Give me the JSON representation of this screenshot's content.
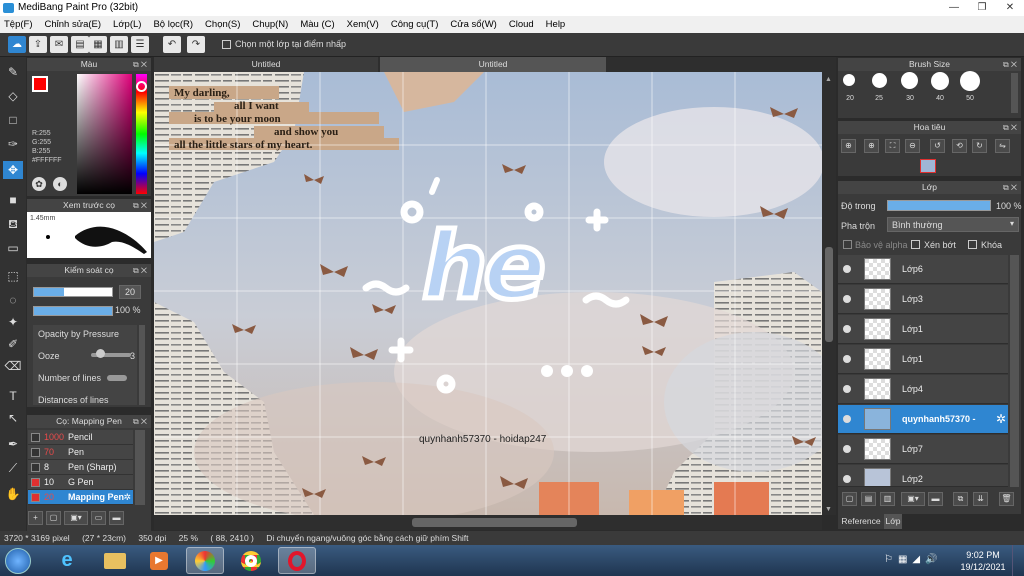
{
  "window": {
    "title": "MediBang Paint Pro (32bit)",
    "controls": [
      "—",
      "❐",
      "✕"
    ]
  },
  "menu": [
    "Tệp(F)",
    "Chỉnh sửa(E)",
    "Lớp(L)",
    "Bộ lọc(R)",
    "Chọn(S)",
    "Chụp(N)",
    "Màu (C)",
    "Xem(V)",
    "Công cụ(T)",
    "Cửa sổ(W)",
    "Cloud",
    "Help"
  ],
  "toolbar": {
    "select_layer_label": "Chọn một lớp tại điểm nhấp"
  },
  "color_panel": {
    "title": "Màu",
    "rgb": [
      "R:255",
      "G:255",
      "B:255"
    ],
    "hex": "#FFFFFF",
    "primary_color": "#ff0000",
    "secondary_color": "#ffffff"
  },
  "brush_preview": {
    "title": "Xem trước cọ",
    "size": "1.45mm"
  },
  "brush_control": {
    "title": "Kiểm soát cọ",
    "size_value": "20",
    "opacity_value": "100 %",
    "opacity_by_pressure": "Opacity by Pressure",
    "ooze_label": "Ooze",
    "ooze_value": "3",
    "number_of_lines": "Number of lines",
    "distances_of_lines": "Distances of lines"
  },
  "brush_list": {
    "title": "Cọ: Mapping Pen",
    "items": [
      {
        "size": "1000",
        "name": "Pencil",
        "color": "#333333"
      },
      {
        "size": "70",
        "name": "Pen",
        "color": "#333333"
      },
      {
        "size": "8",
        "name": "Pen (Sharp)",
        "color": "#333333"
      },
      {
        "size": "10",
        "name": "G Pen",
        "color": "#e03030"
      },
      {
        "size": "20",
        "name": "Mapping Pen",
        "color": "#e03030"
      }
    ]
  },
  "canvas": {
    "tabs": [
      "Untitled",
      "Untitled"
    ],
    "poem_lines": [
      "My darling,",
      "all I want",
      "is to be your moon",
      "and show you",
      "all the little stars of my heart."
    ],
    "main_text": "he",
    "credit": "quynhanh57370 - hoidap247"
  },
  "brush_size_panel": {
    "title": "Brush Size",
    "sizes": [
      "20",
      "25",
      "30",
      "40",
      "50"
    ]
  },
  "navigator_panel": {
    "title": "Hoa tiêu"
  },
  "layer_panel": {
    "title": "Lớp",
    "opacity_label": "Độ trong",
    "opacity_value": "100 %",
    "opacity_fraction": 1.0,
    "blend_label": "Pha trộn",
    "blend_value": "Bình thường",
    "protect_alpha": "Bảo vệ alpha",
    "clipping": "Xén bớt",
    "lock": "Khóa",
    "layers": [
      {
        "name": "Lớp6",
        "selected": false
      },
      {
        "name": "Lớp3",
        "selected": false
      },
      {
        "name": "Lớp1",
        "selected": false
      },
      {
        "name": "Lớp1",
        "selected": false
      },
      {
        "name": "Lớp4",
        "selected": false
      },
      {
        "name": "quynhanh57370 -",
        "selected": true
      },
      {
        "name": "Lớp7",
        "selected": false
      },
      {
        "name": "Lớp2",
        "selected": false
      }
    ],
    "bottom_tabs": [
      "Reference",
      "Lớp"
    ]
  },
  "status": {
    "pixels": "3720 * 3169 pixel",
    "size_cm": "(27 * 23cm)",
    "dpi": "350 dpi",
    "zoom": "25 %",
    "coords": "( 88, 2410 )",
    "hint": "Di chuyển ngang/vuông góc bằng cách giữ phím Shift"
  },
  "taskbar": {
    "time": "9:02 PM",
    "date": "19/12/2021"
  }
}
